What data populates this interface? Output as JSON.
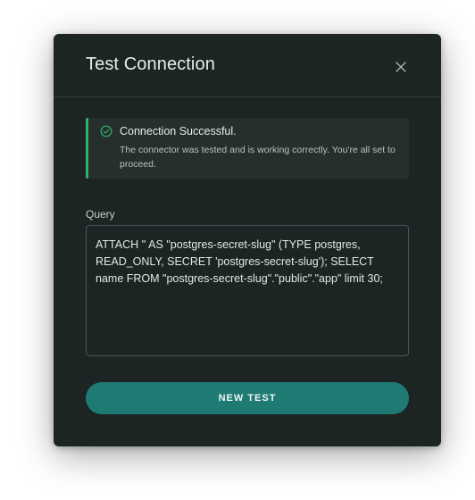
{
  "dialog": {
    "title": "Test Connection"
  },
  "alert": {
    "title": "Connection Successful.",
    "message": "The connector was tested and is working correctly. You're all set to proceed.",
    "status_color": "#2fb36b"
  },
  "query": {
    "label": "Query",
    "value": "ATTACH '' AS \"postgres-secret-slug\" (TYPE postgres, READ_ONLY, SECRET 'postgres-secret-slug'); SELECT name FROM \"postgres-secret-slug\".\"public\".\"app\" limit 30;"
  },
  "actions": {
    "new_test_label": "NEW TEST",
    "accent_color": "#1e7a72"
  },
  "icons": {
    "close": "close-icon",
    "success": "check-circle-icon"
  }
}
